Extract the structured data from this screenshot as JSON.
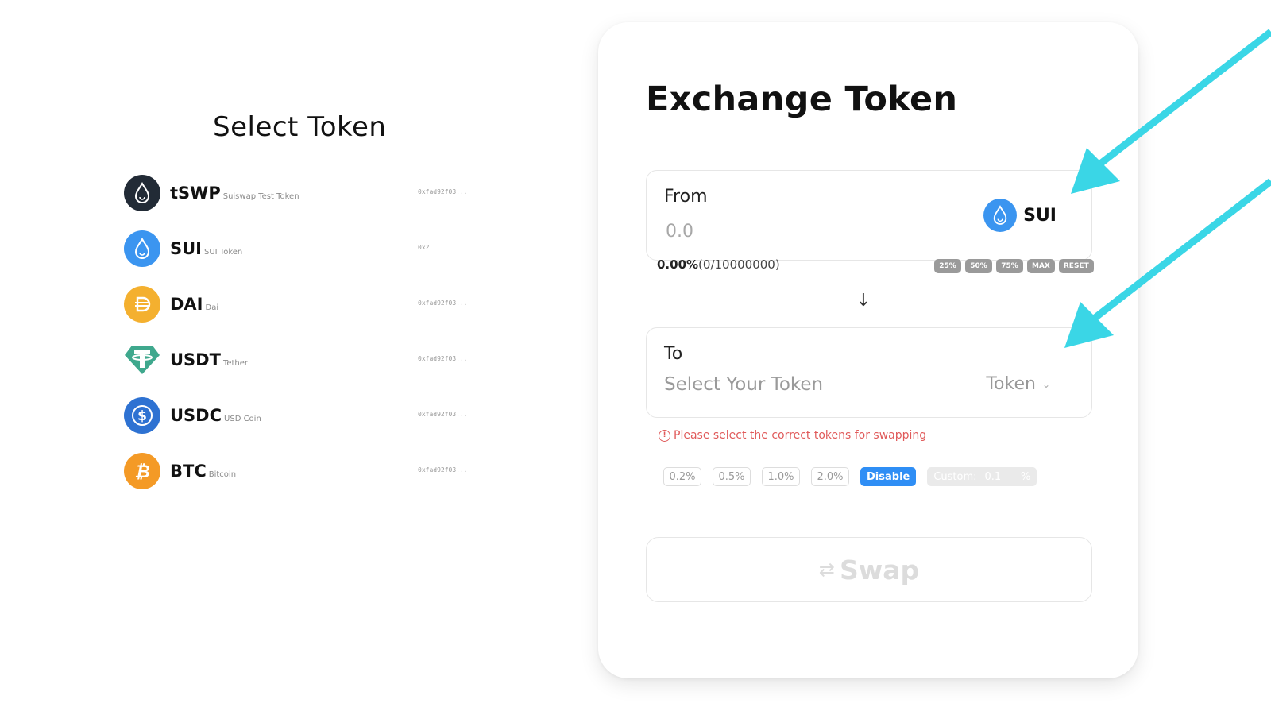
{
  "select_panel": {
    "title": "Select Token",
    "tokens": [
      {
        "symbol": "tSWP",
        "name": "Suiswap Test Token",
        "address": "0xfad92f03...",
        "icon": "tswp-drop-icon",
        "color": "#222b36"
      },
      {
        "symbol": "SUI",
        "name": "SUI Token",
        "address": "0x2",
        "icon": "sui-drop-icon",
        "color": "#3b95f0"
      },
      {
        "symbol": "DAI",
        "name": "Dai",
        "address": "0xfad92f03...",
        "icon": "dai-icon",
        "color": "#f4b02f"
      },
      {
        "symbol": "USDT",
        "name": "Tether",
        "address": "0xfad92f03...",
        "icon": "usdt-icon",
        "color": "#3fa88d"
      },
      {
        "symbol": "USDC",
        "name": "USD Coin",
        "address": "0xfad92f03...",
        "icon": "usdc-icon",
        "color": "#2e72d2"
      },
      {
        "symbol": "BTC",
        "name": "Bitcoin",
        "address": "0xfad92f03...",
        "icon": "btc-icon",
        "color": "#f49a26"
      }
    ]
  },
  "exchange": {
    "title": "Exchange Token",
    "from": {
      "label": "From",
      "placeholder": "0.0",
      "token_symbol": "SUI"
    },
    "balance": {
      "percent": "0.00%",
      "detail": "(0/10000000)"
    },
    "percent_buttons": [
      "25%",
      "50%",
      "75%",
      "MAX",
      "RESET"
    ],
    "to": {
      "label": "To",
      "placeholder": "Select Your Token",
      "dropdown_label": "Token"
    },
    "warning": "Please select the correct tokens for swapping",
    "slippage": {
      "options": [
        "0.2%",
        "0.5%",
        "1.0%",
        "2.0%"
      ],
      "active_label": "Disable",
      "custom_label": "Custom:",
      "custom_value": "0.1",
      "custom_unit": "%"
    },
    "swap_label": "Swap"
  },
  "colors": {
    "accent": "#2f8ef5",
    "warning": "#e05a5a",
    "annotation_arrow": "#3ad6e6"
  }
}
